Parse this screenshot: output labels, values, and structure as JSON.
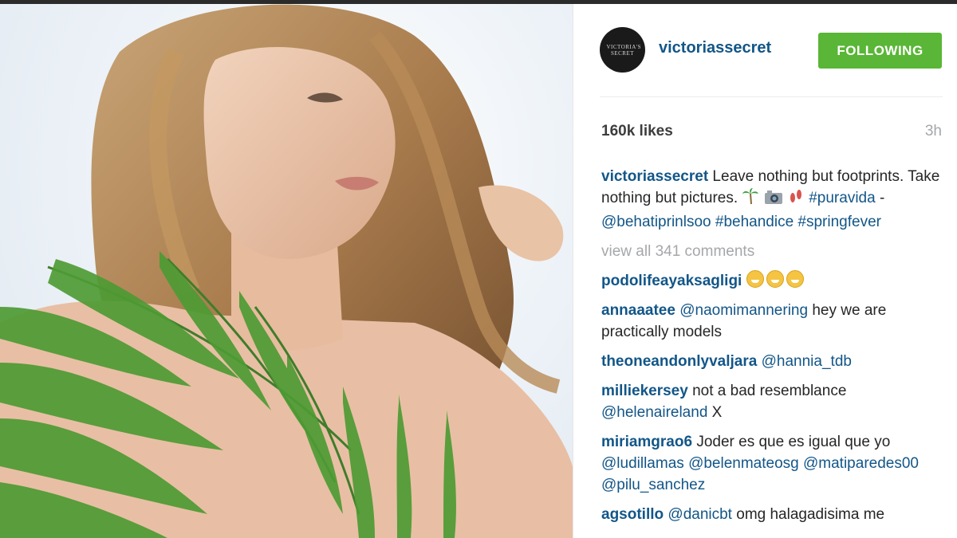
{
  "post": {
    "username": "victoriassecret",
    "avatar_text": "VICTORIA'S SECRET",
    "follow_label": "FOLLOWING",
    "likes": "160k likes",
    "time": "3h",
    "caption": {
      "user": "victoriassecret",
      "text_1": " Leave nothing but footprints. Take nothing but pictures. ",
      "hashtag_1": "#puravida",
      "sep": " - ",
      "mention": "@behatiprinlsoo",
      "hashtag_2": "#behandice",
      "hashtag_3": "#springfever"
    },
    "view_all": "view all 341 comments"
  },
  "comments": [
    {
      "user": "podolifeayaksagligi"
    },
    {
      "user": "annaaatee",
      "mention": "@naomimannering",
      "text": " hey we are practically models"
    },
    {
      "user": "theoneandonlyvaljara",
      "mention": "@hannia_tdb"
    },
    {
      "user": "milliekersey",
      "text": " not a bad resemblance ",
      "mention": "@helenaireland",
      "text_2": " X"
    },
    {
      "user": "miriamgrao6",
      "text": " Joder es que es igual que yo ",
      "m1": "@ludillamas",
      "m2": "@belenmateosg",
      "m3": "@matiparedes00",
      "m4": "@pilu_sanchez"
    },
    {
      "user": "agsotillo",
      "mention": "@danicbt",
      "text": " omg halagadisima me"
    }
  ],
  "colors": {
    "link": "#125688",
    "follow_button": "#59b636",
    "muted": "#a5a7aa"
  },
  "icons": [
    "palm-tree-icon",
    "camera-icon",
    "footprints-icon",
    "grin-emoji-icon"
  ]
}
